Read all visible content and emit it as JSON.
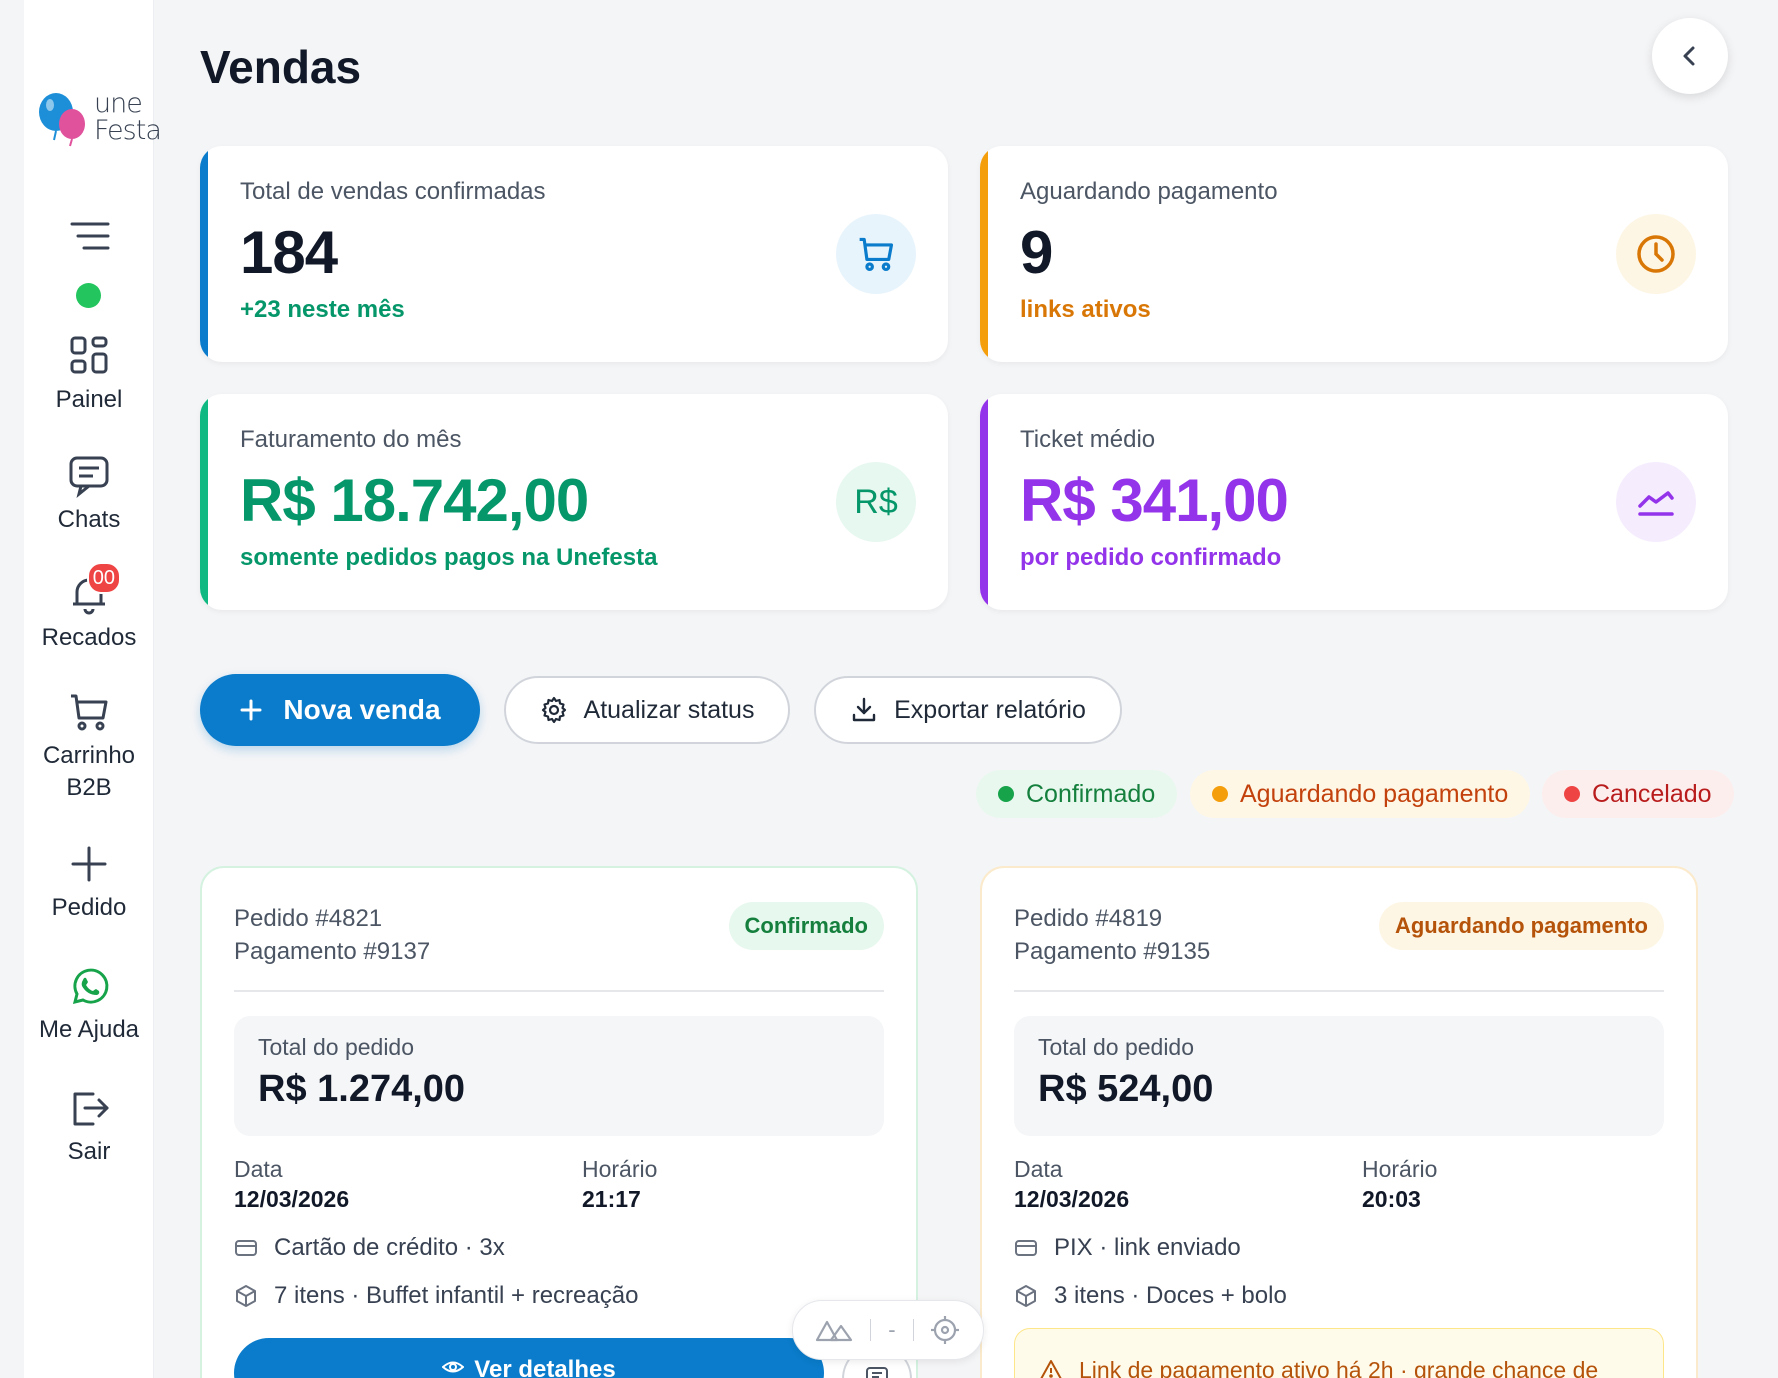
{
  "app": {
    "brand_line1": "une",
    "brand_line2": "Festa",
    "page_title": "Vendas"
  },
  "sidebar": {
    "items": [
      {
        "label": "Painel",
        "icon": "grid-icon"
      },
      {
        "label": "Chats",
        "icon": "chat-icon"
      },
      {
        "label": "Recados",
        "icon": "bell-icon",
        "badge": "00"
      },
      {
        "label_line1": "Carrinho",
        "label_line2": "B2B",
        "icon": "cart-icon"
      },
      {
        "label": "Pedido",
        "icon": "plus-icon"
      },
      {
        "label": "Me Ajuda",
        "icon": "whatsapp-icon"
      },
      {
        "label": "Sair",
        "icon": "logout-icon"
      }
    ],
    "status": "online"
  },
  "stats": [
    {
      "label": "Total de vendas confirmadas",
      "value": "184",
      "sub": "+23 neste mês",
      "accent": "#0a7ccb",
      "sub_color": "#059669",
      "icon": "cart-icon"
    },
    {
      "label": "Aguardando pagamento",
      "value": "9",
      "sub": "links ativos",
      "accent": "#f59e0b",
      "sub_color": "#d97706",
      "icon": "clock-icon"
    },
    {
      "label": "Faturamento do mês",
      "value": "R$ 18.742,00",
      "sub": "somente pedidos pagos na Unefesta",
      "accent": "#10b981",
      "sub_color": "#059669",
      "icon_text": "R$"
    },
    {
      "label": "Ticket médio",
      "value": "R$ 341,00",
      "sub": "por pedido confirmado",
      "accent": "#9333ea",
      "sub_color": "#9333ea",
      "icon": "trend-icon"
    }
  ],
  "actions": {
    "new_sale": "Nova venda",
    "update_status": "Atualizar status",
    "export_report": "Exportar relatório"
  },
  "legend": [
    {
      "label": "Confirmado",
      "color": "#16a34a"
    },
    {
      "label": "Aguardando pagamento",
      "color": "#f59e0b"
    },
    {
      "label": "Cancelado",
      "color": "#ef4444"
    }
  ],
  "orders": [
    {
      "order": "Pedido #4821",
      "payment": "Pagamento #9137",
      "status": "Confirmado",
      "total_label": "Total do pedido",
      "total": "R$ 1.274,00",
      "date_label": "Data",
      "date": "12/03/2026",
      "time_label": "Horário",
      "time": "21:17",
      "method": "Cartão de crédito · 3x",
      "items": "7 itens · Buffet infantil + recreação",
      "button": "Ver detalhes"
    },
    {
      "order": "Pedido #4819",
      "payment": "Pagamento #9135",
      "status": "Aguardando pagamento",
      "total_label": "Total do pedido",
      "total": "R$ 524,00",
      "date_label": "Data",
      "date": "12/03/2026",
      "time_label": "Horário",
      "time": "20:03",
      "method": "PIX · link enviado",
      "items": "3 itens · Doces + bolo",
      "warning": "Link de pagamento ativo há 2h · grande chance de"
    }
  ],
  "floating_tool": {
    "middle": "-"
  }
}
